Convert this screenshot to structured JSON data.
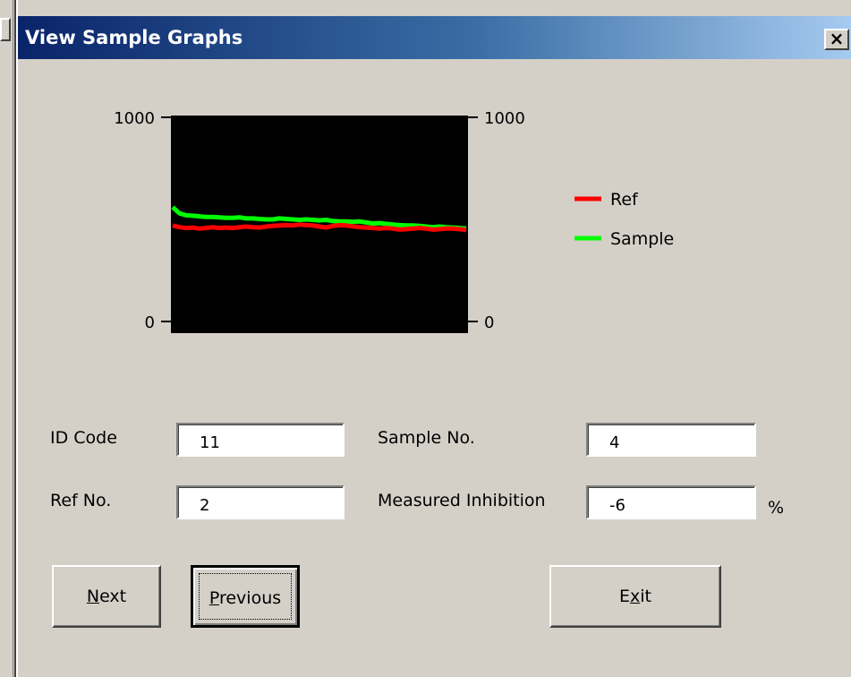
{
  "window": {
    "title": "View Sample Graphs",
    "close_glyph": "×"
  },
  "chart_data": {
    "type": "line",
    "title": "",
    "ylim": [
      0,
      1000
    ],
    "y_ticks_left": [
      "1000",
      "0"
    ],
    "y_ticks_right": [
      "1000",
      "0"
    ],
    "plot_background": "#000000",
    "legend_position": "right",
    "series": [
      {
        "name": "Ref",
        "color": "#ff0000",
        "values": [
          470,
          462,
          458,
          460,
          455,
          458,
          462,
          458,
          460,
          458,
          462,
          465,
          462,
          460,
          465,
          468,
          470,
          472,
          470,
          475,
          472,
          470,
          465,
          460,
          468,
          472,
          470,
          466,
          462,
          460,
          458,
          455,
          458,
          455,
          450,
          452,
          455,
          458,
          455,
          450,
          452,
          455,
          455,
          452,
          448
        ]
      },
      {
        "name": "Sample",
        "color": "#00ff00",
        "values": [
          560,
          530,
          520,
          518,
          515,
          512,
          512,
          510,
          508,
          508,
          510,
          505,
          505,
          502,
          500,
          500,
          505,
          502,
          500,
          498,
          500,
          498,
          495,
          498,
          492,
          490,
          490,
          488,
          490,
          485,
          480,
          482,
          478,
          475,
          472,
          470,
          470,
          468,
          465,
          462,
          465,
          462,
          460,
          458,
          455
        ]
      }
    ]
  },
  "fields": {
    "id_code": {
      "label": "ID Code",
      "value": "11"
    },
    "ref_no": {
      "label": "Ref No.",
      "value": "2"
    },
    "sample_no": {
      "label": "Sample No.",
      "value": "4"
    },
    "inhibition": {
      "label": "Measured Inhibition",
      "value": "-6",
      "unit": "%"
    }
  },
  "buttons": {
    "next": {
      "mnemonic": "N",
      "rest": "ext"
    },
    "previous": {
      "mnemonic": "P",
      "rest": "revious"
    },
    "exit": {
      "pre": "E",
      "mnemonic": "x",
      "rest": "it"
    }
  }
}
